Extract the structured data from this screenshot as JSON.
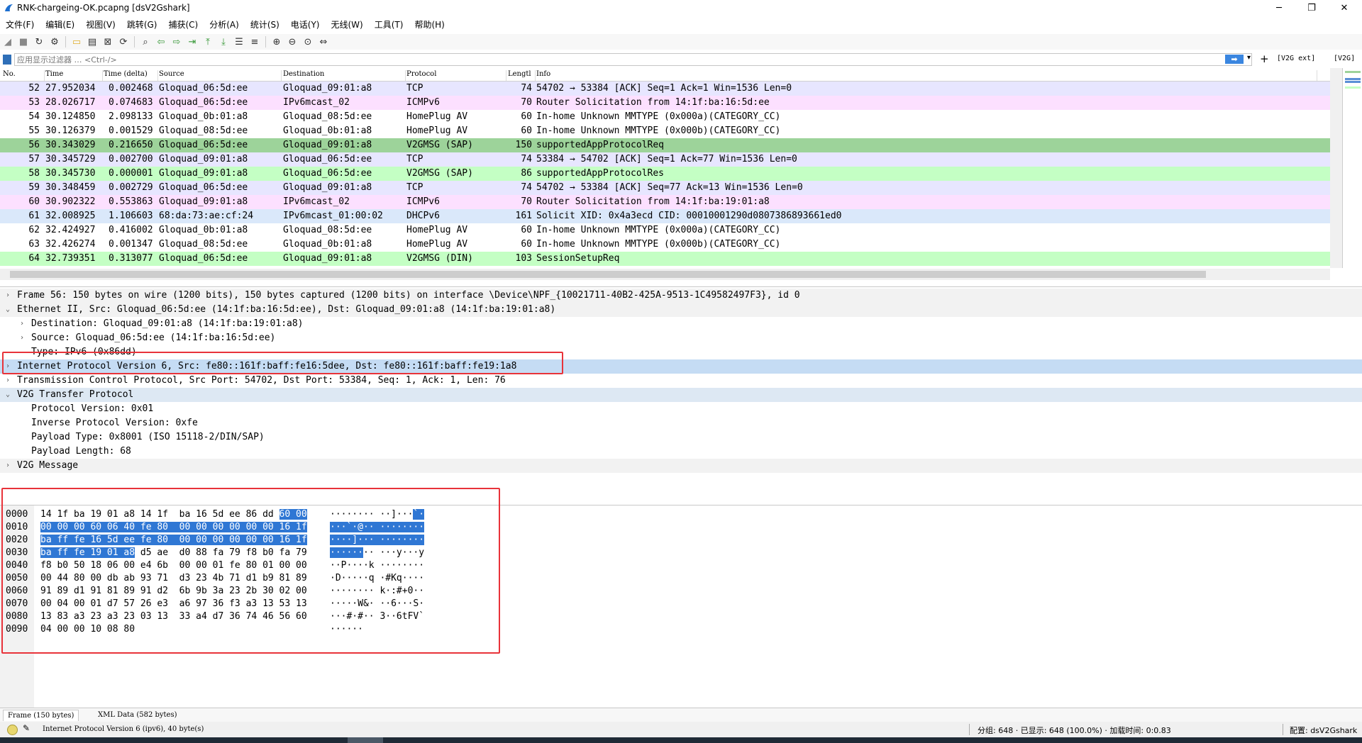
{
  "window": {
    "title": "RNK-chargeing-OK.pcapng [dsV2Gshark]",
    "minimize": "─",
    "maximize": "❐",
    "close": "✕"
  },
  "menu": [
    "文件(F)",
    "编辑(E)",
    "视图(V)",
    "跳转(G)",
    "捕获(C)",
    "分析(A)",
    "统计(S)",
    "电话(Y)",
    "无线(W)",
    "工具(T)",
    "帮助(H)"
  ],
  "toolbar": {
    "icons": [
      "shark-fin-start-icon",
      "stop-icon",
      "restart-icon",
      "options-gear-icon",
      "open-folder-icon",
      "save-icon",
      "close-file-icon",
      "reload-icon",
      "find-icon",
      "go-back-icon",
      "go-forward-icon",
      "go-to-packet-icon",
      "first-packet-icon",
      "last-packet-icon",
      "autoscroll-icon",
      "colorize-icon",
      "zoom-in-icon",
      "zoom-out-icon",
      "normal-size-icon",
      "resize-columns-icon"
    ]
  },
  "filter": {
    "placeholder": "应用显示过滤器 … <Ctrl-/>",
    "apply_glyph": "➡",
    "dropdown_glyph": "▾",
    "plus_glyph": "+",
    "button1": "[V2G ext]",
    "button2": "[V2G]"
  },
  "packet_list": {
    "columns": [
      "No.",
      "Time",
      "Time (delta)",
      "Source",
      "Destination",
      "Protocol",
      "Lengtl",
      "Info"
    ],
    "rows": [
      {
        "no": "52",
        "time": "27.952034",
        "delta": "0.002468",
        "src": "Gloquad_06:5d:ee",
        "dst": "Gloquad_09:01:a8",
        "proto": "TCP",
        "len": "74",
        "info": "54702 → 53384 [ACK] Seq=1 Ack=1 Win=1536 Len=0",
        "kind": "tcp"
      },
      {
        "no": "53",
        "time": "28.026717",
        "delta": "0.074683",
        "src": "Gloquad_06:5d:ee",
        "dst": "IPv6mcast_02",
        "proto": "ICMPv6",
        "len": "70",
        "info": "Router Solicitation from 14:1f:ba:16:5d:ee",
        "kind": "icmp"
      },
      {
        "no": "54",
        "time": "30.124850",
        "delta": "2.098133",
        "src": "Gloquad_0b:01:a8",
        "dst": "Gloquad_08:5d:ee",
        "proto": "HomePlug AV",
        "len": "60",
        "info": "In-home Unknown MMTYPE (0x000a)(CATEGORY_CC)",
        "kind": "homeplug"
      },
      {
        "no": "55",
        "time": "30.126379",
        "delta": "0.001529",
        "src": "Gloquad_08:5d:ee",
        "dst": "Gloquad_0b:01:a8",
        "proto": "HomePlug AV",
        "len": "60",
        "info": "In-home Unknown MMTYPE (0x000b)(CATEGORY_CC)",
        "kind": "homeplug"
      },
      {
        "no": "56",
        "time": "30.343029",
        "delta": "0.216650",
        "src": "Gloquad_06:5d:ee",
        "dst": "Gloquad_09:01:a8",
        "proto": "V2GMSG (SAP)",
        "len": "150",
        "info": "supportedAppProtocolReq",
        "kind": "sel"
      },
      {
        "no": "57",
        "time": "30.345729",
        "delta": "0.002700",
        "src": "Gloquad_09:01:a8",
        "dst": "Gloquad_06:5d:ee",
        "proto": "TCP",
        "len": "74",
        "info": "53384 → 54702 [ACK] Seq=1 Ack=77 Win=1536 Len=0",
        "kind": "tcp"
      },
      {
        "no": "58",
        "time": "30.345730",
        "delta": "0.000001",
        "src": "Gloquad_09:01:a8",
        "dst": "Gloquad_06:5d:ee",
        "proto": "V2GMSG (SAP)",
        "len": "86",
        "info": "supportedAppProtocolRes",
        "kind": "v2g"
      },
      {
        "no": "59",
        "time": "30.348459",
        "delta": "0.002729",
        "src": "Gloquad_06:5d:ee",
        "dst": "Gloquad_09:01:a8",
        "proto": "TCP",
        "len": "74",
        "info": "54702 → 53384 [ACK] Seq=77 Ack=13 Win=1536 Len=0",
        "kind": "tcp"
      },
      {
        "no": "60",
        "time": "30.902322",
        "delta": "0.553863",
        "src": "Gloquad_09:01:a8",
        "dst": "IPv6mcast_02",
        "proto": "ICMPv6",
        "len": "70",
        "info": "Router Solicitation from 14:1f:ba:19:01:a8",
        "kind": "icmp"
      },
      {
        "no": "61",
        "time": "32.008925",
        "delta": "1.106603",
        "src": "68:da:73:ae:cf:24",
        "dst": "IPv6mcast_01:00:02",
        "proto": "DHCPv6",
        "len": "161",
        "info": "Solicit XID: 0x4a3ecd CID: 00010001290d0807386893661ed0",
        "kind": "dhcp"
      },
      {
        "no": "62",
        "time": "32.424927",
        "delta": "0.416002",
        "src": "Gloquad_0b:01:a8",
        "dst": "Gloquad_08:5d:ee",
        "proto": "HomePlug AV",
        "len": "60",
        "info": "In-home Unknown MMTYPE (0x000a)(CATEGORY_CC)",
        "kind": "homeplug"
      },
      {
        "no": "63",
        "time": "32.426274",
        "delta": "0.001347",
        "src": "Gloquad_08:5d:ee",
        "dst": "Gloquad_0b:01:a8",
        "proto": "HomePlug AV",
        "len": "60",
        "info": "In-home Unknown MMTYPE (0x000b)(CATEGORY_CC)",
        "kind": "homeplug"
      },
      {
        "no": "64",
        "time": "32.739351",
        "delta": "0.313077",
        "src": "Gloquad_06:5d:ee",
        "dst": "Gloquad_09:01:a8",
        "proto": "V2GMSG (DIN)",
        "len": "103",
        "info": "SessionSetupReq",
        "kind": "v2g"
      }
    ]
  },
  "details": [
    {
      "indent": 0,
      "arrow": "›",
      "text": "Frame 56: 150 bytes on wire (1200 bits), 150 bytes captured (1200 bits) on interface \\Device\\NPF_{10021711-40B2-425A-9513-1C49582497F3}, id 0",
      "style": "shade"
    },
    {
      "indent": 0,
      "arrow": "⌄",
      "text": "Ethernet II, Src: Gloquad_06:5d:ee (14:1f:ba:16:5d:ee), Dst: Gloquad_09:01:a8 (14:1f:ba:19:01:a8)",
      "style": "shade"
    },
    {
      "indent": 1,
      "arrow": "›",
      "text": "Destination: Gloquad_09:01:a8 (14:1f:ba:19:01:a8)",
      "style": ""
    },
    {
      "indent": 1,
      "arrow": "›",
      "text": "Source: Gloquad_06:5d:ee (14:1f:ba:16:5d:ee)",
      "style": ""
    },
    {
      "indent": 1,
      "arrow": "",
      "text": "Type: IPv6 (0x86dd)",
      "style": ""
    },
    {
      "indent": 0,
      "arrow": "›",
      "text": "Internet Protocol Version 6, Src: fe80::161f:baff:fe16:5dee, Dst: fe80::161f:baff:fe19:1a8",
      "style": "sel"
    },
    {
      "indent": 0,
      "arrow": "›",
      "text": "Transmission Control Protocol, Src Port: 54702, Dst Port: 53384, Seq: 1, Ack: 1, Len: 76",
      "style": ""
    },
    {
      "indent": 0,
      "arrow": "⌄",
      "text": "V2G Transfer Protocol",
      "style": "v2g"
    },
    {
      "indent": 1,
      "arrow": "",
      "text": "Protocol Version: 0x01",
      "style": ""
    },
    {
      "indent": 1,
      "arrow": "",
      "text": "Inverse Protocol Version: 0xfe",
      "style": ""
    },
    {
      "indent": 1,
      "arrow": "",
      "text": "Payload Type: 0x8001 (ISO 15118-2/DIN/SAP)",
      "style": ""
    },
    {
      "indent": 1,
      "arrow": "",
      "text": "Payload Length: 68",
      "style": ""
    },
    {
      "indent": 0,
      "arrow": "›",
      "text": "V2G Message",
      "style": "shade"
    }
  ],
  "bytes": [
    {
      "off": "0000",
      "pre": "14 1f ba 19 01 a8 14 1f  ba 16 5d ee 86 dd ",
      "hl": "60 00",
      "post": "",
      "apre": "········ ··]···",
      "ahl": "`·",
      "apost": ""
    },
    {
      "off": "0010",
      "pre": "",
      "hl": "00 00 00 60 06 40 fe 80  00 00 00 00 00 00 16 1f",
      "post": "",
      "apre": "",
      "ahl": "···`·@·· ········",
      "apost": ""
    },
    {
      "off": "0020",
      "pre": "",
      "hl": "ba ff fe 16 5d ee fe 80  00 00 00 00 00 00 16 1f",
      "post": "",
      "apre": "",
      "ahl": "····]··· ········",
      "apost": ""
    },
    {
      "off": "0030",
      "pre": "",
      "hl": "ba ff fe 19 01 a8",
      "post": " d5 ae  d0 88 fa 79 f8 b0 fa 79",
      "apre": "",
      "ahl": "······",
      "apost": "·· ···y···y"
    },
    {
      "off": "0040",
      "pre": "f8 b0 50 18 06 00 e4 6b  00 00 01 fe 80 01 00 00",
      "hl": "",
      "post": "",
      "apre": "··P····k ········",
      "ahl": "",
      "apost": ""
    },
    {
      "off": "0050",
      "pre": "00 44 80 00 db ab 93 71  d3 23 4b 71 d1 b9 81 89",
      "hl": "",
      "post": "",
      "apre": "·D·····q ·#Kq····",
      "ahl": "",
      "apost": ""
    },
    {
      "off": "0060",
      "pre": "91 89 d1 91 81 89 91 d2  6b 9b 3a 23 2b 30 02 00",
      "hl": "",
      "post": "",
      "apre": "········ k·:#+0··",
      "ahl": "",
      "apost": ""
    },
    {
      "off": "0070",
      "pre": "00 04 00 01 d7 57 26 e3  a6 97 36 f3 a3 13 53 13",
      "hl": "",
      "post": "",
      "apre": "·····W&· ··6···S·",
      "ahl": "",
      "apost": ""
    },
    {
      "off": "0080",
      "pre": "13 83 a3 23 a3 23 03 13  33 a4 d7 36 74 46 56 60",
      "hl": "",
      "post": "",
      "apre": "···#·#·· 3··6tFV`",
      "ahl": "",
      "apost": ""
    },
    {
      "off": "0090",
      "pre": "04 00 00 10 08 80",
      "hl": "",
      "post": "",
      "apre": "······",
      "ahl": "",
      "apost": ""
    }
  ],
  "tabs": [
    "Frame (150 bytes)",
    "XML Data (582 bytes)"
  ],
  "status": {
    "message": "Internet Protocol Version 6 (ipv6), 40 byte(s)",
    "stats": "分组: 648 · 已显示: 648 (100.0%) · 加载时间: 0:0.83",
    "profile": "配置: dsV2Gshark"
  },
  "colors": {
    "tcp": "#e7e6ff",
    "icmp": "#fce0ff",
    "v2g": "#c4ffc4",
    "selected": "#9dd39a",
    "dhcp": "#dae8fa",
    "highlight": "#2f77d4",
    "redbox": "#e8333a"
  }
}
